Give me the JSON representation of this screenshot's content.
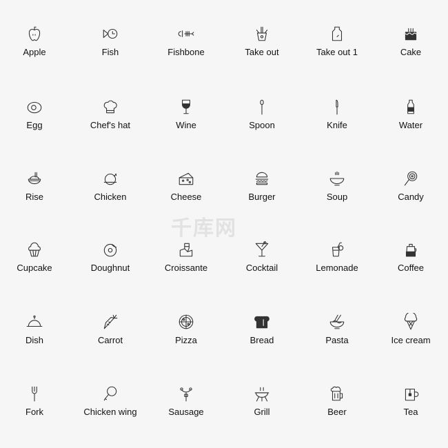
{
  "watermark": "千库网",
  "colors": {
    "background": "#f6f6f6",
    "icon_stroke": "#333333",
    "label": "#111111"
  },
  "rows": [
    [
      {
        "label": "Apple",
        "icon": "apple-icon"
      },
      {
        "label": "Fish",
        "icon": "fish-icon"
      },
      {
        "label": "Fishbone",
        "icon": "fishbone-icon"
      },
      {
        "label": "Take out",
        "icon": "takeout-box-icon"
      },
      {
        "label": "Take out 1",
        "icon": "takeout-bag-icon"
      },
      {
        "label": "Cake",
        "icon": "cake-icon"
      }
    ],
    [
      {
        "label": "Egg",
        "icon": "egg-icon"
      },
      {
        "label": "Chef's hat",
        "icon": "chef-hat-icon"
      },
      {
        "label": "Wine",
        "icon": "wine-icon"
      },
      {
        "label": "Spoon",
        "icon": "spoon-icon"
      },
      {
        "label": "Knife",
        "icon": "knife-icon"
      },
      {
        "label": "Water",
        "icon": "water-bottle-icon"
      }
    ],
    [
      {
        "label": "Rise",
        "icon": "rice-bowl-icon"
      },
      {
        "label": "Chicken",
        "icon": "chicken-icon"
      },
      {
        "label": "Cheese",
        "icon": "cheese-icon"
      },
      {
        "label": "Burger",
        "icon": "burger-icon"
      },
      {
        "label": "Soup",
        "icon": "soup-icon"
      },
      {
        "label": "Candy",
        "icon": "candy-icon"
      }
    ],
    [
      {
        "label": "Cupcake",
        "icon": "cupcake-icon"
      },
      {
        "label": "Doughnut",
        "icon": "doughnut-icon"
      },
      {
        "label": "Croissante",
        "icon": "croissant-icon"
      },
      {
        "label": "Cocktail",
        "icon": "cocktail-icon"
      },
      {
        "label": "Lemonade",
        "icon": "lemonade-icon"
      },
      {
        "label": "Coffee",
        "icon": "coffee-pot-icon"
      }
    ],
    [
      {
        "label": "Dish",
        "icon": "cloche-icon"
      },
      {
        "label": "Carrot",
        "icon": "carrot-icon"
      },
      {
        "label": "Pizza",
        "icon": "pizza-icon"
      },
      {
        "label": "Bread",
        "icon": "bread-icon"
      },
      {
        "label": "Pasta",
        "icon": "pasta-icon"
      },
      {
        "label": "Ice cream",
        "icon": "ice-cream-icon"
      }
    ],
    [
      {
        "label": "Fork",
        "icon": "fork-icon"
      },
      {
        "label": "Chicken wing",
        "icon": "chicken-wing-icon"
      },
      {
        "label": "Sausage",
        "icon": "sausage-icon"
      },
      {
        "label": "Grill",
        "icon": "grill-icon"
      },
      {
        "label": "Beer",
        "icon": "beer-icon"
      },
      {
        "label": "Tea",
        "icon": "tea-icon"
      }
    ]
  ]
}
